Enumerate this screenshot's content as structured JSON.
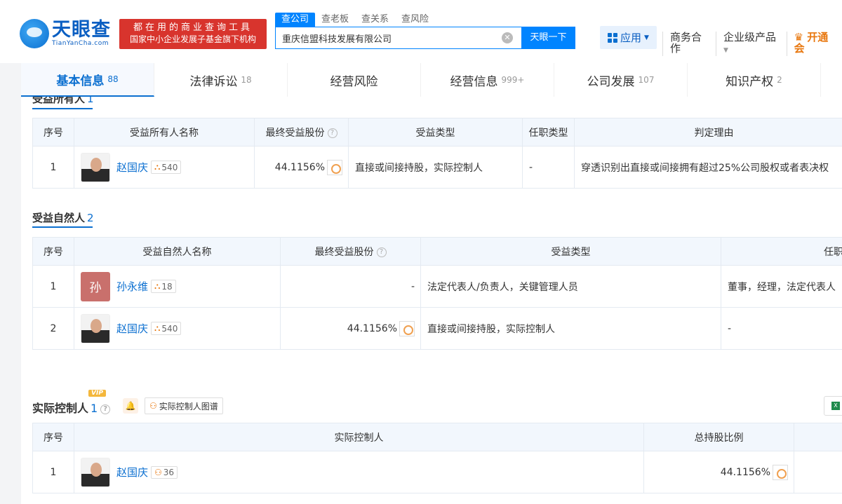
{
  "header": {
    "logo_cn": "天眼查",
    "logo_en": "TianYanCha.com",
    "slogan_line1": "都在用的商业查询工具",
    "slogan_line2": "国家中小企业发展子基金旗下机构",
    "search_tabs": [
      "查公司",
      "查老板",
      "查关系",
      "查风险"
    ],
    "search_value": "重庆信盟科技发展有限公司",
    "search_button": "天眼一下",
    "app_button": "应用",
    "nav": [
      "商务合作",
      "企业级产品",
      "开通会"
    ]
  },
  "tabs": [
    {
      "label": "基本信息",
      "count": "88"
    },
    {
      "label": "法律诉讼",
      "count": "18"
    },
    {
      "label": "经营风险",
      "count": ""
    },
    {
      "label": "经营信息",
      "count": "999+"
    },
    {
      "label": "公司发展",
      "count": "107"
    },
    {
      "label": "知识产权",
      "count": "2"
    }
  ],
  "beneficial_owner": {
    "title": "受益所有人",
    "count": "1",
    "headers": [
      "序号",
      "受益所有人名称",
      "最终受益股份",
      "受益类型",
      "任职类型",
      "判定理由"
    ],
    "rows": [
      {
        "no": "1",
        "name": "赵国庆",
        "tag": "540",
        "share": "44.1156%",
        "type": "直接或间接持股，实际控制人",
        "position": "-",
        "reason": "穿透识别出直接或间接拥有超过25%公司股权或者表决权"
      }
    ]
  },
  "natural_person": {
    "title": "受益自然人",
    "count": "2",
    "headers": [
      "序号",
      "受益自然人名称",
      "最终受益股份",
      "受益类型",
      "任职类"
    ],
    "rows": [
      {
        "no": "1",
        "avatar_letter": "孙",
        "name": "孙永维",
        "tag": "18",
        "share": "-",
        "type": "法定代表人/负责人，关键管理人员",
        "position": "董事，经理，法定代表人"
      },
      {
        "no": "2",
        "name": "赵国庆",
        "tag": "540",
        "share": "44.1156%",
        "type": "直接或间接持股，实际控制人",
        "position": "-"
      }
    ]
  },
  "controller": {
    "title": "实际控制人",
    "count": "1",
    "vip": "VIP",
    "graph_button": "实际控制人图谱",
    "headers": [
      "序号",
      "实际控制人",
      "总持股比例"
    ],
    "rows": [
      {
        "no": "1",
        "name": "赵国庆",
        "tag": "36",
        "share": "44.1156%"
      }
    ]
  }
}
